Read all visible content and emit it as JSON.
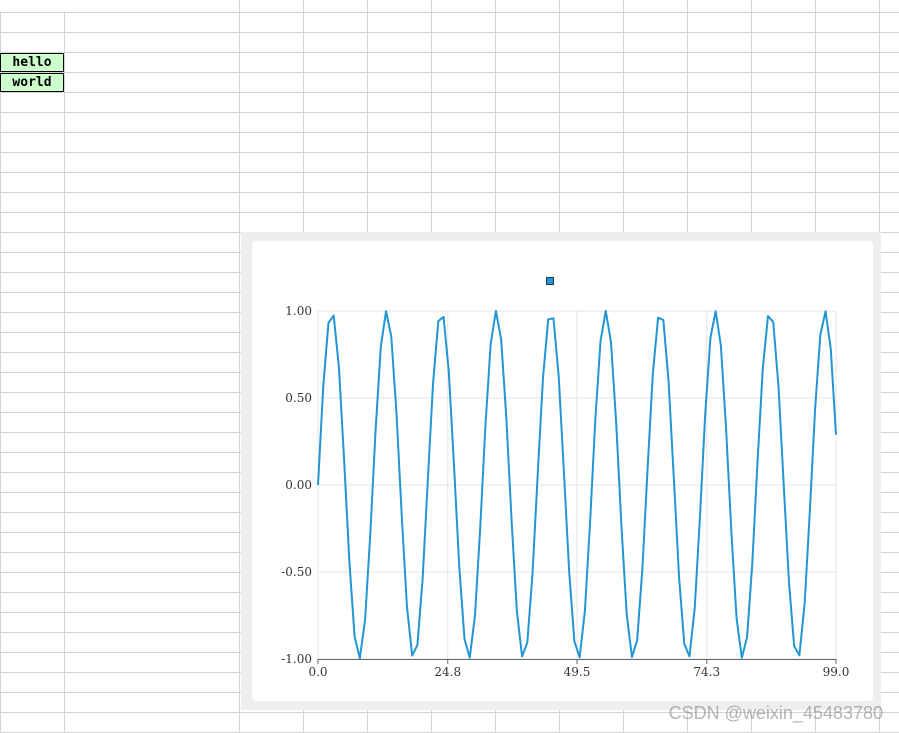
{
  "sheet": {
    "cells": [
      {
        "ref": "A3",
        "value": "hello"
      },
      {
        "ref": "A4",
        "value": "world"
      }
    ],
    "colors": {
      "cell_fill": "#ccffcc",
      "gridline": "#d4d4d4"
    }
  },
  "watermark": "CSDN @weixin_45483780",
  "chart_data": {
    "type": "line",
    "title": "",
    "xlabel": "",
    "ylabel": "",
    "xlim": [
      0,
      99
    ],
    "ylim": [
      -1,
      1
    ],
    "x_ticks": [
      "0.0",
      "24.8",
      "49.5",
      "74.3",
      "99.0"
    ],
    "y_ticks": [
      "1.00",
      "0.50",
      "0.00",
      "-0.50",
      "-1.00"
    ],
    "grid": true,
    "legend": "top-center",
    "colors": {
      "series": "#2196d3",
      "grid": "#e6e6e6",
      "axis": "#666666"
    },
    "series": [
      {
        "formula": "sin(0.6 * x)",
        "values": [
          0.0,
          0.565,
          0.932,
          0.974,
          0.675,
          0.141,
          -0.443,
          -0.872,
          -0.996,
          -0.773,
          -0.279,
          0.312,
          0.794,
          0.999,
          0.855,
          0.412,
          -0.174,
          -0.699,
          -0.98,
          -0.919,
          -0.537,
          0.034,
          0.589,
          0.942,
          0.966,
          0.65,
          0.108,
          -0.471,
          -0.885,
          -0.993,
          -0.751,
          -0.249,
          0.342,
          0.811,
          1.0,
          0.838,
          0.384,
          -0.206,
          -0.722,
          -0.985,
          -0.906,
          -0.509,
          0.068,
          0.616,
          0.952,
          0.958,
          0.625,
          0.074,
          -0.497,
          -0.899,
          -0.99,
          -0.727,
          -0.215,
          0.375,
          0.829,
          1.0,
          0.82,
          0.352,
          -0.238,
          -0.743,
          -0.989,
          -0.891,
          -0.48,
          0.101,
          0.642,
          0.962,
          0.948,
          0.597,
          0.042,
          -0.527,
          -0.913,
          -0.985,
          -0.707,
          -0.183,
          0.405,
          0.845,
          0.999,
          0.801,
          0.32,
          -0.268,
          -0.766,
          -0.993,
          -0.876,
          -0.452,
          0.134,
          0.666,
          0.971,
          0.937,
          0.571,
          0.007,
          -0.553,
          -0.925,
          -0.979,
          -0.683,
          -0.152,
          0.434,
          0.862,
          0.998,
          0.781,
          0.289
        ]
      }
    ]
  }
}
